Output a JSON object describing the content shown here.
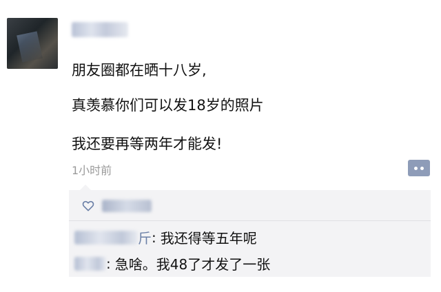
{
  "post": {
    "lines": [
      "朋友圈都在晒十八岁,",
      "真羡慕你们可以发18岁的照片",
      "我还要再等两年才能发!"
    ],
    "timestamp": "1小时前"
  },
  "comments": [
    {
      "name_visible_part": "斤",
      "separator": ":",
      "text": "我还得等五年呢"
    },
    {
      "name_visible_part": "",
      "separator": ":",
      "text": "急啥。我48了才发了一张"
    }
  ],
  "icons": {
    "comment_button": "more-options-icon",
    "like": "heart-outline-icon"
  },
  "colors": {
    "name_link": "#6a7fa6",
    "comment_button_bg": "#8e9cb8",
    "comment_panel_bg": "#f3f3f5"
  }
}
